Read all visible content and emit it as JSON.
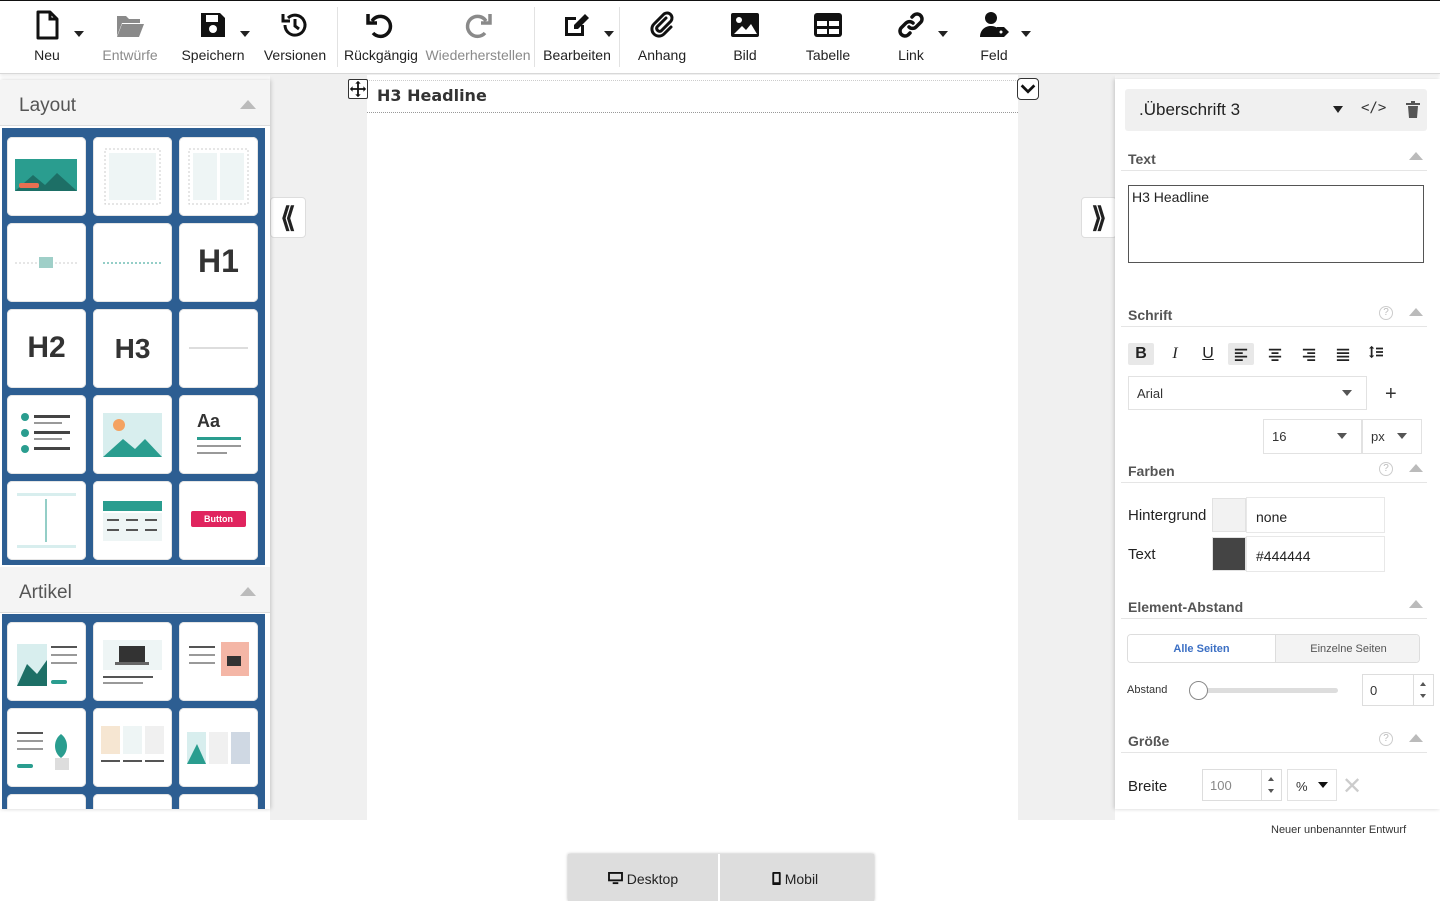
{
  "toolbar": {
    "items": [
      {
        "label": "Neu",
        "icon": "file-icon"
      },
      {
        "label": "Entwürfe",
        "icon": "folder-open-icon"
      },
      {
        "label": "Speichern",
        "icon": "floppy-icon"
      },
      {
        "label": "Versionen",
        "icon": "history-icon"
      },
      {
        "label": "Rückgängig",
        "icon": "undo-icon"
      },
      {
        "label": "Wiederherstellen",
        "icon": "redo-icon"
      },
      {
        "label": "Bearbeiten",
        "icon": "edit-icon"
      },
      {
        "label": "Anhang",
        "icon": "paperclip-icon"
      },
      {
        "label": "Bild",
        "icon": "image-icon"
      },
      {
        "label": "Tabelle",
        "icon": "table-icon"
      },
      {
        "label": "Link",
        "icon": "link-icon"
      },
      {
        "label": "Feld",
        "icon": "user-tag-icon"
      }
    ]
  },
  "left_panel": {
    "layout_title": "Layout",
    "article_title": "Artikel",
    "tiles": {
      "h1": "H1",
      "h2": "H2",
      "h3": "H3",
      "aa": "Aa",
      "button": "Button"
    }
  },
  "canvas": {
    "heading_text": "H3 Headline",
    "collapse_left": "⟪",
    "collapse_right": "⟫"
  },
  "right_panel": {
    "element_type": ".Überschrift 3",
    "code_icon": "</>",
    "text_section": "Text",
    "text_value": "H3 Headline",
    "font_section": "Schrift",
    "font_family": "Arial",
    "font_size": "16",
    "font_unit": "px",
    "add": "+",
    "colors_section": "Farben",
    "bg_label": "Hintergrund",
    "bg_value": "none",
    "text_color_label": "Text",
    "text_color_value": "#444444",
    "text_color_hex": "#444444",
    "spacing_section": "Element-Abstand",
    "all_sides": "Alle Seiten",
    "single_sides": "Einzelne Seiten",
    "spacing_label": "Abstand",
    "spacing_value": "0",
    "size_section": "Größe",
    "width_label": "Breite",
    "width_value": "100",
    "width_unit": "%",
    "help": "?",
    "format": {
      "bold": "B",
      "italic": "I",
      "underline": "U"
    }
  },
  "footer": {
    "draft_name": "Neuer unbenannter Entwurf",
    "desktop": "Desktop",
    "mobile": "Mobil"
  },
  "colors": {
    "accent": "#2d5e92",
    "teal": "#2a9d8f",
    "button_red": "#e0245e"
  }
}
